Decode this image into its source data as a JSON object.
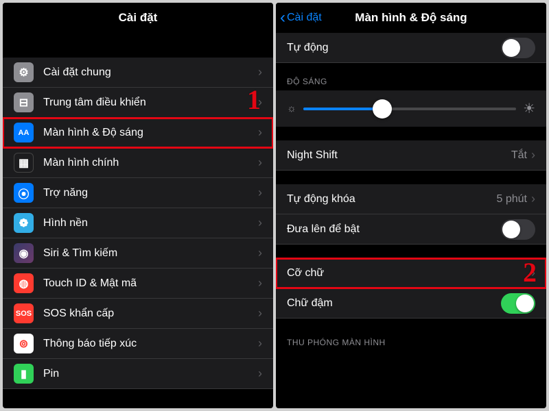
{
  "left": {
    "title": "Cài đặt",
    "callout": "1",
    "rows": [
      {
        "label": "Cài đặt chung",
        "icon": "gear",
        "bg": "ic-gray"
      },
      {
        "label": "Trung tâm điều khiển",
        "icon": "sliders",
        "bg": "ic-gray2"
      },
      {
        "label": "Màn hình & Độ sáng",
        "icon": "AA",
        "bg": "ic-blue",
        "highlight": true
      },
      {
        "label": "Màn hình chính",
        "icon": "grid",
        "bg": "ic-dark"
      },
      {
        "label": "Trợ năng",
        "icon": "person",
        "bg": "ic-acc"
      },
      {
        "label": "Hình nền",
        "icon": "flower",
        "bg": "ic-cyan"
      },
      {
        "label": "Siri & Tìm kiếm",
        "icon": "siri",
        "bg": "ic-siri"
      },
      {
        "label": "Touch ID & Mật mã",
        "icon": "finger",
        "bg": "ic-red"
      },
      {
        "label": "SOS khẩn cấp",
        "icon": "SOS",
        "bg": "ic-red2"
      },
      {
        "label": "Thông báo tiếp xúc",
        "icon": "exposure",
        "bg": "ic-white"
      },
      {
        "label": "Pin",
        "icon": "battery",
        "bg": "ic-green"
      }
    ]
  },
  "right": {
    "back": "Cài đặt",
    "title": "Màn hình & Độ sáng",
    "callout": "2",
    "auto_label": "Tự động",
    "auto_on": false,
    "brightness_header": "ĐỘ SÁNG",
    "brightness_pct": 37,
    "night_shift_label": "Night Shift",
    "night_shift_value": "Tắt",
    "auto_lock_label": "Tự động khóa",
    "auto_lock_value": "5 phút",
    "raise_label": "Đưa lên để bật",
    "raise_on": false,
    "text_size_label": "Cỡ chữ",
    "text_size_highlight": true,
    "bold_label": "Chữ đậm",
    "bold_on": true,
    "zoom_header": "THU PHÓNG MÀN HÌNH"
  }
}
